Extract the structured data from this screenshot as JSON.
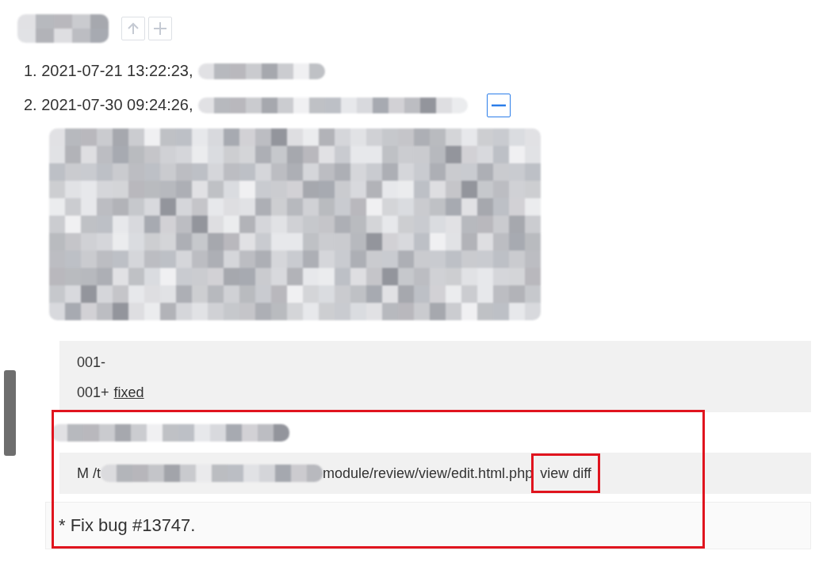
{
  "history": [
    {
      "number": "1.",
      "timestamp": "2021-07-21 13:22:23,",
      "expanded": false
    },
    {
      "number": "2.",
      "timestamp": "2021-07-30 09:24:26,",
      "expanded": true,
      "diff": [
        {
          "prefix": "001-"
        },
        {
          "prefix": "001+",
          "text": "fixed"
        }
      ],
      "file": {
        "action": "M",
        "path_start": "/t",
        "path_end": "module/review/view/edit.html.php",
        "link": "view diff"
      },
      "comment": "* Fix bug #13747."
    }
  ]
}
